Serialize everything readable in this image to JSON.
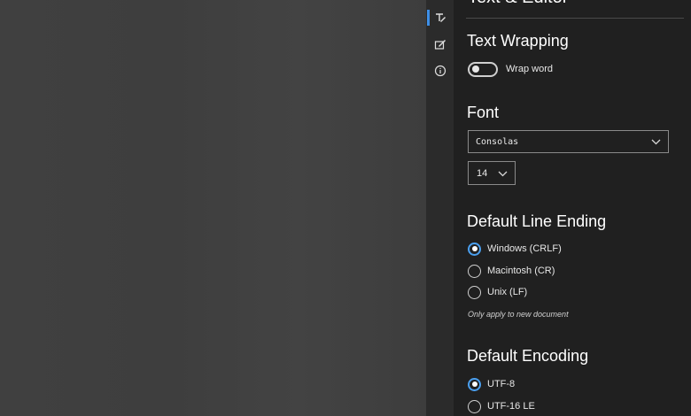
{
  "settings": {
    "title": "Text & Editor",
    "nav": [
      {
        "icon": "text-editor-icon",
        "active": true
      },
      {
        "icon": "edit-personalize-icon",
        "active": false
      },
      {
        "icon": "info-icon",
        "active": false
      }
    ],
    "text_wrapping": {
      "heading": "Text Wrapping",
      "toggle_label": "Wrap word",
      "enabled": false
    },
    "font": {
      "heading": "Font",
      "family": "Consolas",
      "size": "14"
    },
    "line_ending": {
      "heading": "Default Line Ending",
      "options": [
        "Windows (CRLF)",
        "Macintosh (CR)",
        "Unix (LF)"
      ],
      "selected": "Windows (CRLF)",
      "note": "Only apply to new document"
    },
    "encoding": {
      "heading": "Default Encoding",
      "options": [
        "UTF-8",
        "UTF-16 LE"
      ],
      "selected": "UTF-8"
    }
  },
  "colors": {
    "accent": "#4a9fef",
    "panel_bg": "#202020",
    "rail_bg": "#2b2b2b",
    "editor_bg": "#3e3e3e"
  }
}
